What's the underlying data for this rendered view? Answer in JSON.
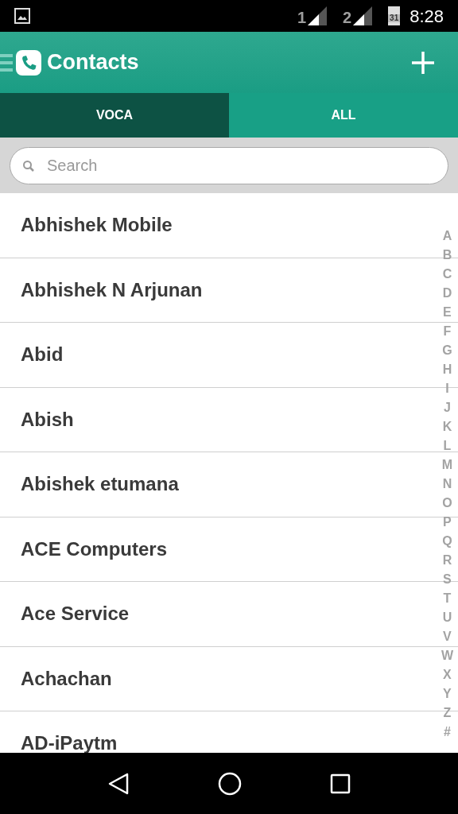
{
  "status_bar": {
    "sim1": "1",
    "sim2": "2",
    "calendar_day": "31",
    "time": "8:28"
  },
  "header": {
    "title": "Contacts"
  },
  "tabs": [
    {
      "label": "VOCA",
      "selected": true
    },
    {
      "label": "ALL",
      "selected": false
    }
  ],
  "search": {
    "placeholder": "Search"
  },
  "contacts": [
    "Abhishek Mobile",
    "Abhishek N Arjunan",
    "Abid",
    "Abish",
    "Abishek etumana",
    "ACE Computers",
    "Ace Service",
    "Achachan",
    "AD-iPaytm"
  ],
  "index": [
    "A",
    "B",
    "C",
    "D",
    "E",
    "F",
    "G",
    "H",
    "I",
    "J",
    "K",
    "L",
    "M",
    "N",
    "O",
    "P",
    "Q",
    "R",
    "S",
    "T",
    "U",
    "V",
    "W",
    "X",
    "Y",
    "Z",
    "#"
  ]
}
